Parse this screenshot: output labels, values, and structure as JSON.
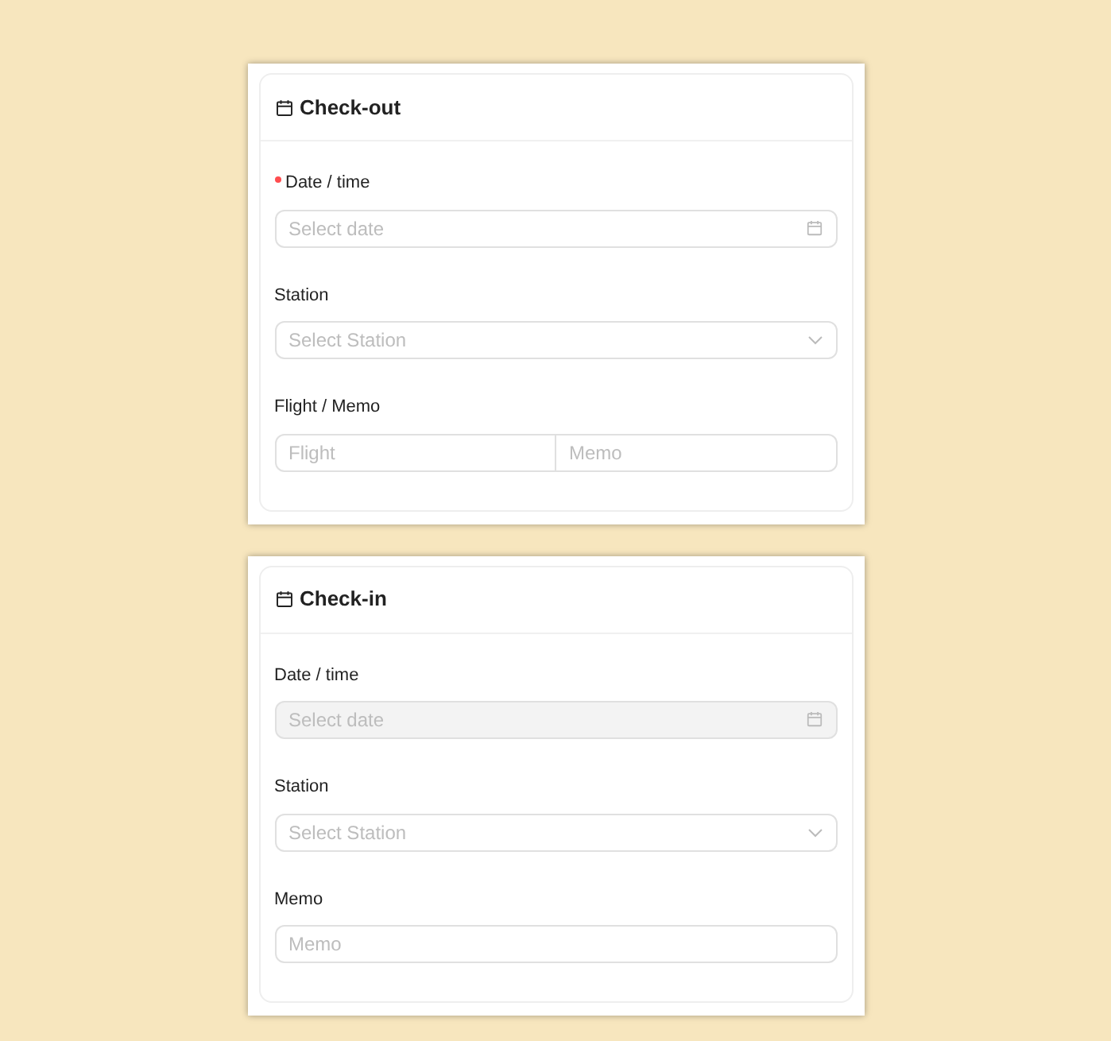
{
  "cards": [
    {
      "title": "Check-out",
      "fields": [
        {
          "kind": "date",
          "label": "Date / time",
          "required": true,
          "disabled": false,
          "placeholder": "Select date"
        },
        {
          "kind": "select",
          "label": "Station",
          "required": false,
          "disabled": false,
          "placeholder": "Select Station"
        },
        {
          "kind": "split",
          "label": "Flight / Memo",
          "required": false,
          "disabled": false,
          "placeholders": [
            "Flight",
            "Memo"
          ]
        }
      ]
    },
    {
      "title": "Check-in",
      "fields": [
        {
          "kind": "date",
          "label": "Date / time",
          "required": false,
          "disabled": true,
          "placeholder": "Select date"
        },
        {
          "kind": "select",
          "label": "Station",
          "required": false,
          "disabled": false,
          "placeholder": "Select Station"
        },
        {
          "kind": "text",
          "label": "Memo",
          "required": false,
          "disabled": false,
          "placeholder": "Memo"
        }
      ]
    }
  ]
}
